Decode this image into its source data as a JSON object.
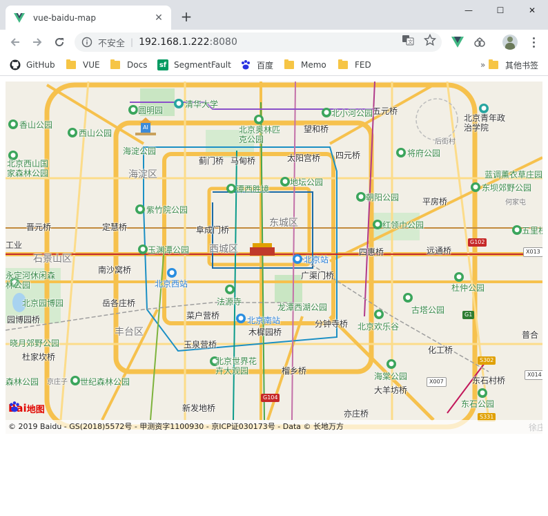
{
  "browser": {
    "tab_title": "vue-baidu-map",
    "new_tab_symbol": "+",
    "close_symbol": "✕",
    "security_label": "不安全",
    "url_host": "192.168.1.222",
    "url_port": ":8080",
    "window_controls": [
      "—",
      "☐",
      "✕"
    ]
  },
  "bookmarks": [
    {
      "label": "GitHub",
      "icon": "github-icon"
    },
    {
      "label": "VUE",
      "icon": "folder-icon"
    },
    {
      "label": "Docs",
      "icon": "folder-icon"
    },
    {
      "label": "SegmentFault",
      "icon": "segmentfault-icon"
    },
    {
      "label": "百度",
      "icon": "baidu-paw-icon"
    },
    {
      "label": "Memo",
      "icon": "folder-icon"
    },
    {
      "label": "FED",
      "icon": "folder-icon"
    }
  ],
  "other_bookmarks": "其他书签",
  "map": {
    "districts": [
      "海淀区",
      "东城区",
      "西城区",
      "石景山区",
      "丰台区"
    ],
    "places": [
      "清华大学",
      "圆明园",
      "香山公园",
      "西山公园",
      "海淀公园",
      "北京西山国家森林公园",
      "北京奥林匹克公园",
      "望和桥",
      "北小河公园",
      "五元桥",
      "北京青年政治学院",
      "后街村",
      "蓟门桥",
      "马甸桥",
      "太阳宫桥",
      "四元桥",
      "将府公园",
      "蓝调薰衣草庄园",
      "东坝郊野公园",
      "潭西胜境",
      "地坛公园",
      "朝阳公园",
      "平房桥",
      "何家屯",
      "紫竹院公园",
      "晋元桥",
      "定慧桥",
      "阜成门桥",
      "红领巾公园",
      "五里桥",
      "玉渊潭公园",
      "远通桥",
      "四惠桥",
      "北京站",
      "南沙窝桥",
      "北京西站",
      "广渠门桥",
      "永定河休闲森林公园",
      "杜仲公园",
      "北京园博园",
      "岳各庄桥",
      "法源寺",
      "龙潭西湖公园",
      "古塔公园",
      "园博园桥",
      "菜户营桥",
      "北京南站",
      "分钟寺桥",
      "北京欢乐谷",
      "木樨园桥",
      "晓月郊野公园",
      "杜家坎桥",
      "玉泉营桥",
      "化工桥",
      "北京世界花卉大观园",
      "榴乡桥",
      "海棠公园",
      "东石村桥",
      "大羊坊桥",
      "世纪森林公园",
      "新发地桥",
      "亦庄桥",
      "东石公园",
      "普合",
      "徐庄",
      "工业",
      "森林公园",
      "京庄子"
    ],
    "road_signs": [
      "G102",
      "X013",
      "G1",
      "S302",
      "X007",
      "X014",
      "G104",
      "S331"
    ],
    "logo_text": "Bai",
    "logo_text2": "地图",
    "copyright": "© 2019 Baidu - GS(2018)5572号 - 甲测资字1100930 - 京ICP证030173号 - Data © 长地万方"
  }
}
